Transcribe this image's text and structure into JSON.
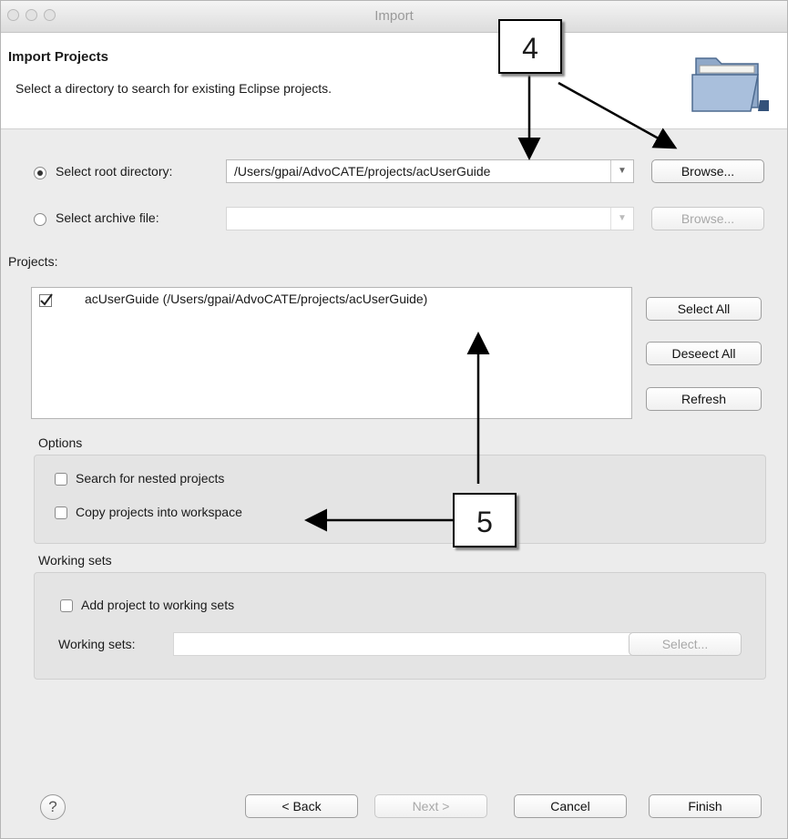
{
  "window": {
    "title": "Import"
  },
  "header": {
    "title": "Import Projects",
    "description": "Select a directory to search for existing Eclipse projects."
  },
  "root_dir": {
    "label": "Select root directory:",
    "value": "/Users/gpai/AdvoCATE/projects/acUserGuide",
    "browse_label": "Browse...",
    "selected": true
  },
  "archive": {
    "label": "Select archive file:",
    "value": "",
    "browse_label": "Browse...",
    "selected": false
  },
  "projects": {
    "label": "Projects:",
    "items": [
      {
        "checked": true,
        "text": "acUserGuide (/Users/gpai/AdvoCATE/projects/acUserGuide)"
      }
    ],
    "select_all_label": "Select All",
    "deselect_all_label": "Deseect All",
    "refresh_label": "Refresh"
  },
  "options": {
    "title": "Options",
    "nested_label": "Search for nested projects",
    "copy_label": "Copy projects into workspace"
  },
  "working_sets": {
    "title": "Working sets",
    "add_label": "Add project to working sets",
    "field_label": "Working sets:",
    "select_label": "Select..."
  },
  "footer": {
    "help_icon": "?",
    "back_label": "< Back",
    "next_label": "Next >",
    "cancel_label": "Cancel",
    "finish_label": "Finish"
  },
  "callouts": {
    "four": "4",
    "five": "5"
  }
}
